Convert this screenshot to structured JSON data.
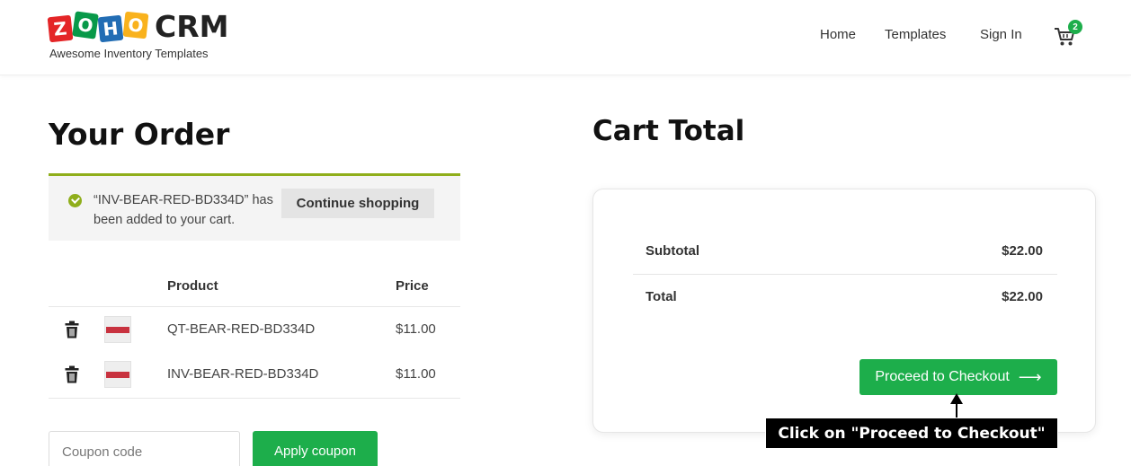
{
  "brand": {
    "logo_letters": [
      "Z",
      "O",
      "H",
      "O"
    ],
    "logo_product": "CRM",
    "tagline": "Awesome Inventory Templates"
  },
  "nav": {
    "home": "Home",
    "templates": "Templates",
    "sign_in": "Sign In",
    "cart_count": "2",
    "cart_icon": "cart-icon"
  },
  "order": {
    "title": "Your Order",
    "notice_text": "“INV-BEAR-RED-BD334D” has been added to your cart.",
    "continue_label": "Continue shopping",
    "columns": [
      "Product",
      "Price"
    ],
    "items": [
      {
        "name": "QT-BEAR-RED-BD334D",
        "price": "$11.00"
      },
      {
        "name": "INV-BEAR-RED-BD334D",
        "price": "$11.00"
      }
    ],
    "coupon_placeholder": "Coupon code",
    "apply_coupon_label": "Apply coupon"
  },
  "cart_total": {
    "title": "Cart Total",
    "subtotal_label": "Subtotal",
    "subtotal_value": "$22.00",
    "total_label": "Total",
    "total_value": "$22.00",
    "checkout_label": "Proceed to Checkout",
    "checkout_arrow": "⟶"
  },
  "annotation": {
    "text": "Click on \"Proceed to Checkout\""
  },
  "colors": {
    "accent_green": "#1dae4b",
    "notice_border": "#8fae1b"
  }
}
